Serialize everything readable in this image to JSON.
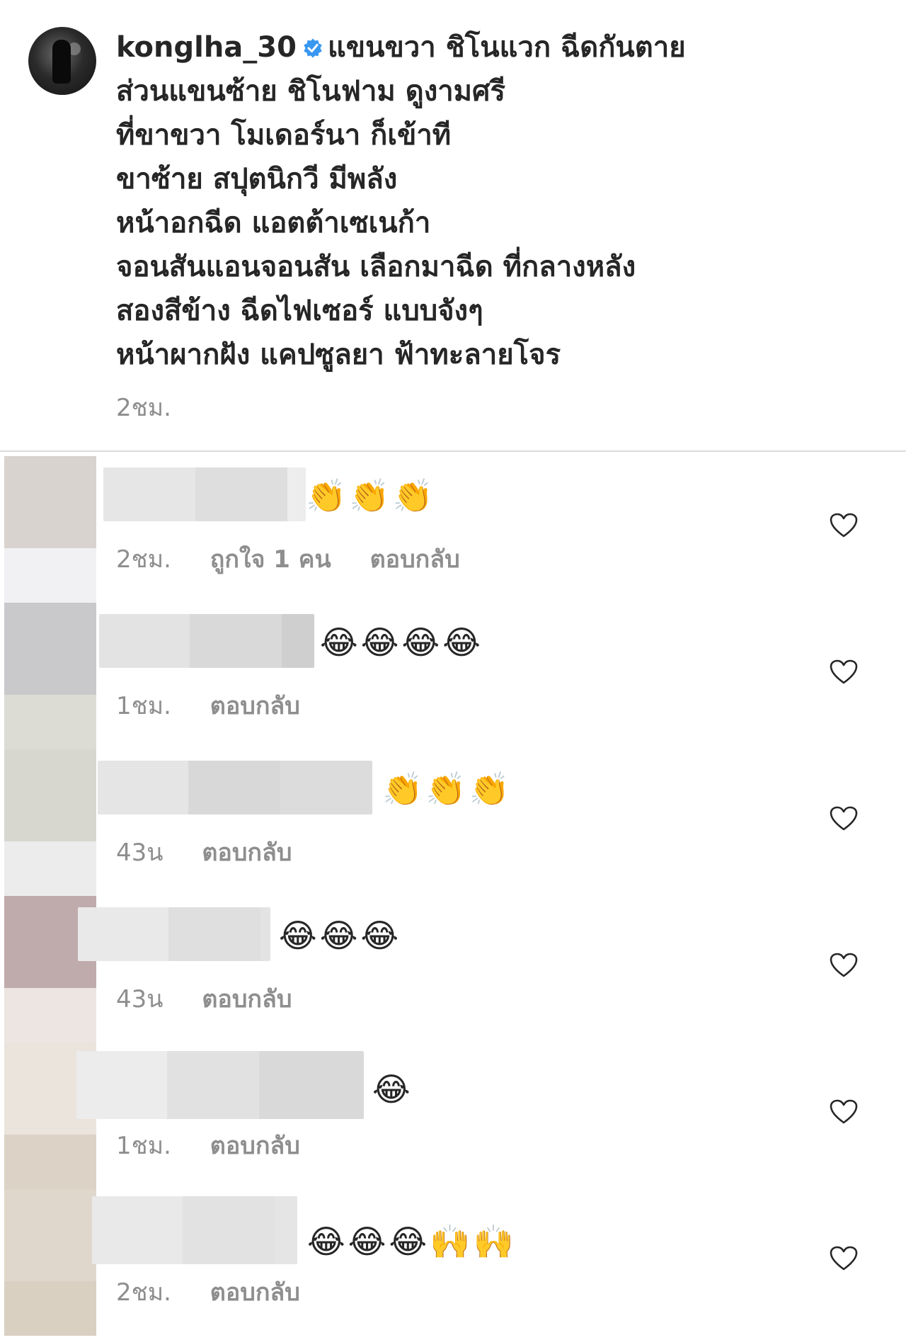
{
  "post": {
    "username": "konglha_30",
    "verified_icon": "verified-badge-icon",
    "caption_lines": [
      "แขนขวา ชิโนแวก ฉีดกันตาย",
      "ส่วนแขนซ้าย ชิโนฟาม ดูงามศรี",
      "ที่ขาขวา โมเดอร์นา ก็เข้าที",
      "ขาซ้าย สปุตนิกวี มีพลัง",
      "หน้าอกฉีด แอตต้าเซเนก้า",
      "จอนสันแอนจอนสัน เลือกมาฉีด ที่กลางหลัง",
      "สองสีข้าง ฉีดไฟเซอร์ แบบจังๆ",
      "หน้าผากฝัง แคปซูลยา ฟ้าทะลายโจร"
    ],
    "time": "2ชม."
  },
  "comments": [
    {
      "emoji": "👏👏👏",
      "time": "2ชม.",
      "likes": "ถูกใจ 1 คน",
      "reply": "ตอบกลับ",
      "avatar_colors": [
        "#d9d3cf",
        "#f1f1f4"
      ],
      "name_colors": [
        "#e6e6e6",
        "#dedede",
        "#ededed"
      ],
      "like_icon": "heart-outline-icon"
    },
    {
      "emoji": "😂😂😂😂",
      "time": "1ชม.",
      "likes": "",
      "reply": "ตอบกลับ",
      "avatar_colors": [
        "#c9c9cb",
        "#dcdcd5"
      ],
      "name_colors": [
        "#e3e3e3",
        "#d9d9d9",
        "#cfcfcf"
      ],
      "like_icon": "heart-outline-icon"
    },
    {
      "emoji": "👏👏👏",
      "time": "43น",
      "likes": "",
      "reply": "ตอบกลับ",
      "avatar_colors": [
        "#d7d7d0",
        "#ececed"
      ],
      "name_colors": [
        "#e5e5e5",
        "#d8d8d8",
        "#dcdcdc"
      ],
      "like_icon": "heart-outline-icon"
    },
    {
      "emoji": "😂😂😂",
      "time": "43น",
      "likes": "",
      "reply": "ตอบกลับ",
      "avatar_colors": [
        "#bfaaac",
        "#ece5e1"
      ],
      "name_colors": [
        "#e9e9e9",
        "#dfdfdf",
        "#e3e3e3"
      ],
      "like_icon": "heart-outline-icon"
    },
    {
      "emoji": "😂",
      "time": "1ชม.",
      "likes": "",
      "reply": "ตอบกลับ",
      "avatar_colors": [
        "#ebe4dd",
        "#dcd2c5"
      ],
      "name_colors": [
        "#ececec",
        "#e1e1e1",
        "#d9d9d9"
      ],
      "like_icon": "heart-outline-icon"
    },
    {
      "emoji": "😂😂😂🙌🙌",
      "time": "2ชม.",
      "likes": "",
      "reply": "ตอบกลับ",
      "avatar_colors": [
        "#e0d7cc",
        "#dad0c2"
      ],
      "name_colors": [
        "#e9e9e9",
        "#e2e2e2",
        "#e5e5e5"
      ],
      "like_icon": "heart-outline-icon"
    }
  ]
}
